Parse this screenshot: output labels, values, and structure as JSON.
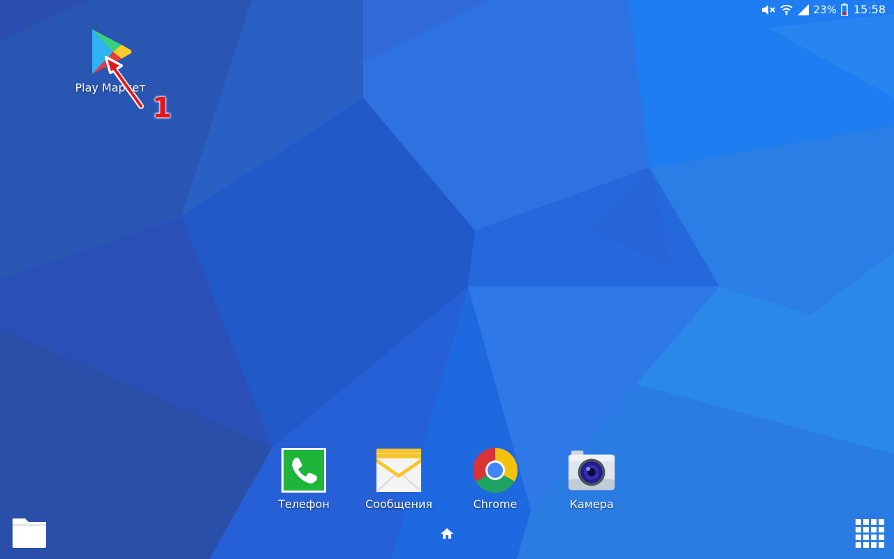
{
  "status_bar": {
    "battery": "23%",
    "time": "15:58",
    "icons": [
      "mute-icon",
      "wifi-icon",
      "signal-icon",
      "battery-icon"
    ]
  },
  "desktop": {
    "apps": [
      {
        "label": "Play Маркет",
        "icon": "play-store-icon"
      }
    ]
  },
  "dock": {
    "apps": [
      {
        "label": "Телефон",
        "icon": "phone-icon",
        "color": "#1db53a"
      },
      {
        "label": "Сообщения",
        "icon": "messages-icon",
        "color": "#f7c52b"
      },
      {
        "label": "Chrome",
        "icon": "chrome-icon",
        "color": "#4285f4"
      },
      {
        "label": "Камера",
        "icon": "camera-icon",
        "color": "#3b2bb3"
      }
    ]
  },
  "navigation": {
    "folder": "folder-icon",
    "home": "home-icon",
    "apps": "apps-grid-icon"
  },
  "annotation": {
    "number": "1",
    "color": "#e8141b"
  }
}
